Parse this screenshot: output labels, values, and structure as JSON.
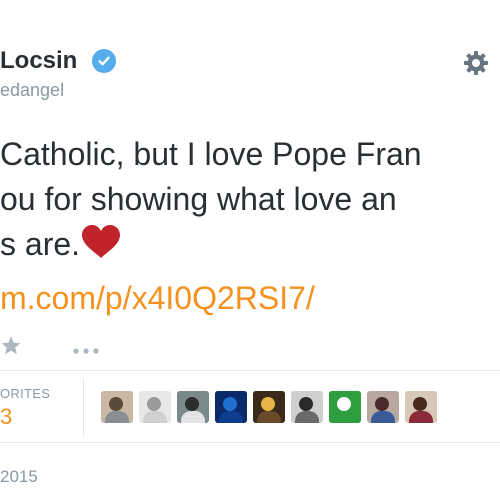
{
  "profile": {
    "display_name": "Locsin",
    "handle": "edangel",
    "verified": true
  },
  "tweet": {
    "lines": [
      "Catholic, but I love Pope Fran",
      "ou for showing what love an",
      "s are."
    ],
    "link": "m.com/p/x4I0Q2RSI7/"
  },
  "stats": {
    "favorites_label": "ORITES",
    "favorites_count": "3"
  },
  "date": "2015",
  "icons": {
    "settings": "gear-icon",
    "verified": "verified-badge-icon",
    "heart": "heart-emoji-icon",
    "favorite": "star-icon",
    "more": "more-dots-icon"
  },
  "colors": {
    "link": "#f4911f",
    "verified": "#55acee",
    "muted": "#8899a6",
    "heart": "#c1232b",
    "divider": "#e1e8ed"
  },
  "favoriters": [
    {
      "name": "favoriter-1",
      "bg": "#c9b9a4",
      "fg": "#5a4a3a",
      "body": "#8a8f96"
    },
    {
      "name": "favoriter-2",
      "bg": "#e8e8e8",
      "fg": "#9a9a9a",
      "body": "#d0d0d0"
    },
    {
      "name": "favoriter-3",
      "bg": "#7a8a8c",
      "fg": "#2c2c2c",
      "body": "#e4e4e4"
    },
    {
      "name": "favoriter-4",
      "bg": "#0a2a6a",
      "fg": "#1f6fd0",
      "body": "#0e3d8f"
    },
    {
      "name": "favoriter-5",
      "bg": "#3a2a1a",
      "fg": "#e5b54a",
      "body": "#6a4a2a"
    },
    {
      "name": "favoriter-6",
      "bg": "#cfcfcf",
      "fg": "#2a2a2a",
      "body": "#6a6a6a"
    },
    {
      "name": "favoriter-7",
      "bg": "#2e9e3e",
      "fg": "#ffffff",
      "body": "#2e9e3e"
    },
    {
      "name": "favoriter-8",
      "bg": "#b8a8a0",
      "fg": "#4a2a2a",
      "body": "#3a5a9a"
    },
    {
      "name": "favoriter-9",
      "bg": "#d8c8b8",
      "fg": "#4a2a1a",
      "body": "#8a2a3a"
    }
  ]
}
